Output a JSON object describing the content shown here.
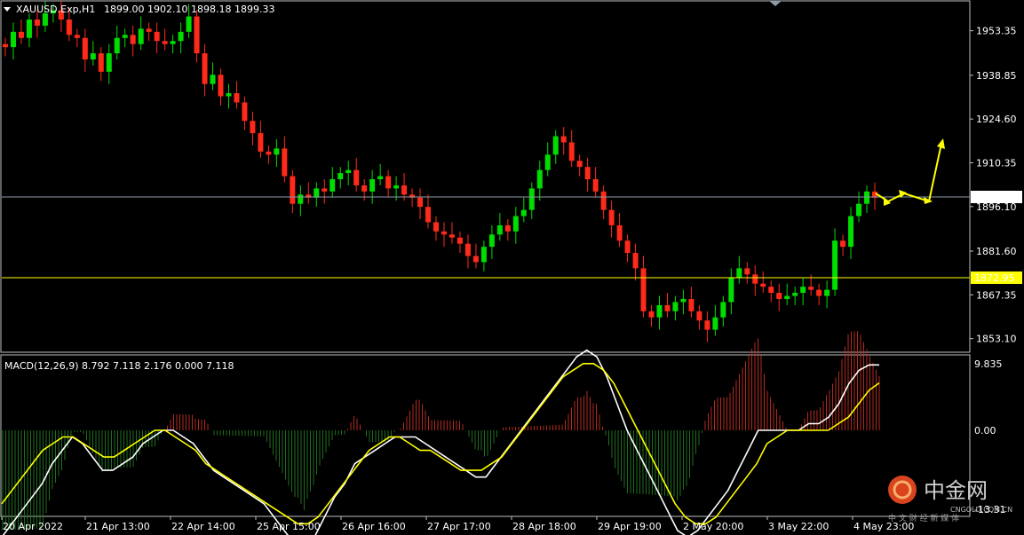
{
  "header": {
    "symbol": "XAUUSD.Exp,H1",
    "ohlc": "1899.00 1902.10 1898.18 1899.33"
  },
  "macd": {
    "label": "MACD(12,26,9) 8.792 7.118 2.176 0.000 7.118",
    "axis_ticks": [
      "9.835",
      "0.00",
      "-13.31"
    ]
  },
  "price_levels": {
    "current": "1899.33",
    "support": "1872.95"
  },
  "watermark": {
    "brand": "中金网",
    "site": "CNGOLD.COM.CN",
    "tagline": "中 文 财 经 新 媒 体"
  },
  "colors": {
    "background": "#000000",
    "bull_candle": "#00dd00",
    "bear_candle": "#ff2a1a",
    "macd_line": "#ffffff",
    "signal_line": "#ffff00",
    "support_line": "#ffff00",
    "current_line": "#8c9aa8",
    "arrows": "#ffff00"
  },
  "chart_data": {
    "type": "candlestick",
    "symbol": "XAUUSD.Exp",
    "timeframe": "H1",
    "y_ticks": [
      "1953.35",
      "1938.85",
      "1924.60",
      "1910.35",
      "1896.10",
      "1881.60",
      "1867.35",
      "1853.10"
    ],
    "ylim": [
      1848,
      1965
    ],
    "x_ticks": [
      "20 Apr 2022",
      "21 Apr 13:00",
      "22 Apr 14:00",
      "25 Apr 15:00",
      "26 Apr 16:00",
      "27 Apr 17:00",
      "28 Apr 18:00",
      "29 Apr 19:00",
      "2 May 20:00",
      "3 May 22:00",
      "4 May 23:00"
    ],
    "closes": [
      1948,
      1953,
      1951,
      1957,
      1955,
      1959,
      1960,
      1957,
      1952,
      1951,
      1944,
      1946,
      1940,
      1946,
      1951,
      1952,
      1949,
      1954,
      1953,
      1950,
      1949,
      1950,
      1953,
      1958,
      1946,
      1936,
      1939,
      1932,
      1933,
      1930,
      1924,
      1920,
      1914,
      1913,
      1915,
      1906,
      1897,
      1900,
      1899,
      1902,
      1901,
      1905,
      1907,
      1908,
      1903,
      1901,
      1905,
      1906,
      1902,
      1903,
      1900,
      1899,
      1896,
      1891,
      1888,
      1887,
      1886,
      1884,
      1880,
      1878,
      1883,
      1887,
      1890,
      1888,
      1893,
      1895,
      1902,
      1908,
      1913,
      1919,
      1917,
      1911,
      1909,
      1905,
      1901,
      1895,
      1890,
      1885,
      1881,
      1876,
      1862,
      1860,
      1864,
      1862,
      1865,
      1866,
      1862,
      1859,
      1856,
      1860,
      1865,
      1873,
      1876,
      1874,
      1871,
      1870,
      1868,
      1866,
      1867,
      1868,
      1870,
      1869,
      1867,
      1869,
      1885,
      1883,
      1893,
      1897,
      1901,
      1899
    ],
    "macd_line": [
      -16,
      -14,
      -12,
      -10,
      -8,
      -5,
      -3,
      -1,
      -2,
      -4,
      -6,
      -6,
      -5,
      -4,
      -2,
      -1,
      0,
      0,
      -1,
      -2,
      -4,
      -6,
      -7,
      -8,
      -9,
      -10,
      -11,
      -13,
      -15,
      -17,
      -18,
      -16,
      -13,
      -10,
      -8,
      -5,
      -4,
      -3,
      -2,
      -1,
      -1,
      -1,
      -2,
      -3,
      -4,
      -5,
      -6,
      -7,
      -7,
      -5,
      -3,
      -1,
      1,
      3,
      5,
      7,
      9,
      11,
      12,
      11,
      8,
      4,
      0,
      -3,
      -6,
      -9,
      -12,
      -15,
      -16,
      -15,
      -13,
      -11,
      -9,
      -6,
      -3,
      0,
      0,
      0,
      0,
      0,
      1,
      1,
      2,
      4,
      7,
      9,
      9.8,
      9.8
    ],
    "signal_line": [
      -11,
      -9,
      -7,
      -5,
      -3,
      -2,
      -1,
      -1,
      -2,
      -3,
      -4,
      -4,
      -3,
      -2,
      -1,
      0,
      0,
      -1,
      -2,
      -3,
      -5,
      -6,
      -7,
      -8,
      -9,
      -10,
      -11,
      -12,
      -13,
      -14,
      -14,
      -13,
      -11,
      -9,
      -7,
      -5,
      -3,
      -2,
      -1,
      -1,
      -2,
      -3,
      -3,
      -4,
      -5,
      -6,
      -6,
      -6,
      -5,
      -4,
      -2,
      0,
      2,
      4,
      6,
      8,
      9,
      10,
      10,
      9,
      7,
      4,
      1,
      -2,
      -5,
      -8,
      -11,
      -13,
      -14,
      -14,
      -13,
      -11,
      -9,
      -7,
      -5,
      -2,
      -1,
      0,
      0,
      0,
      0,
      0,
      1,
      2,
      4,
      6,
      7.1
    ]
  }
}
